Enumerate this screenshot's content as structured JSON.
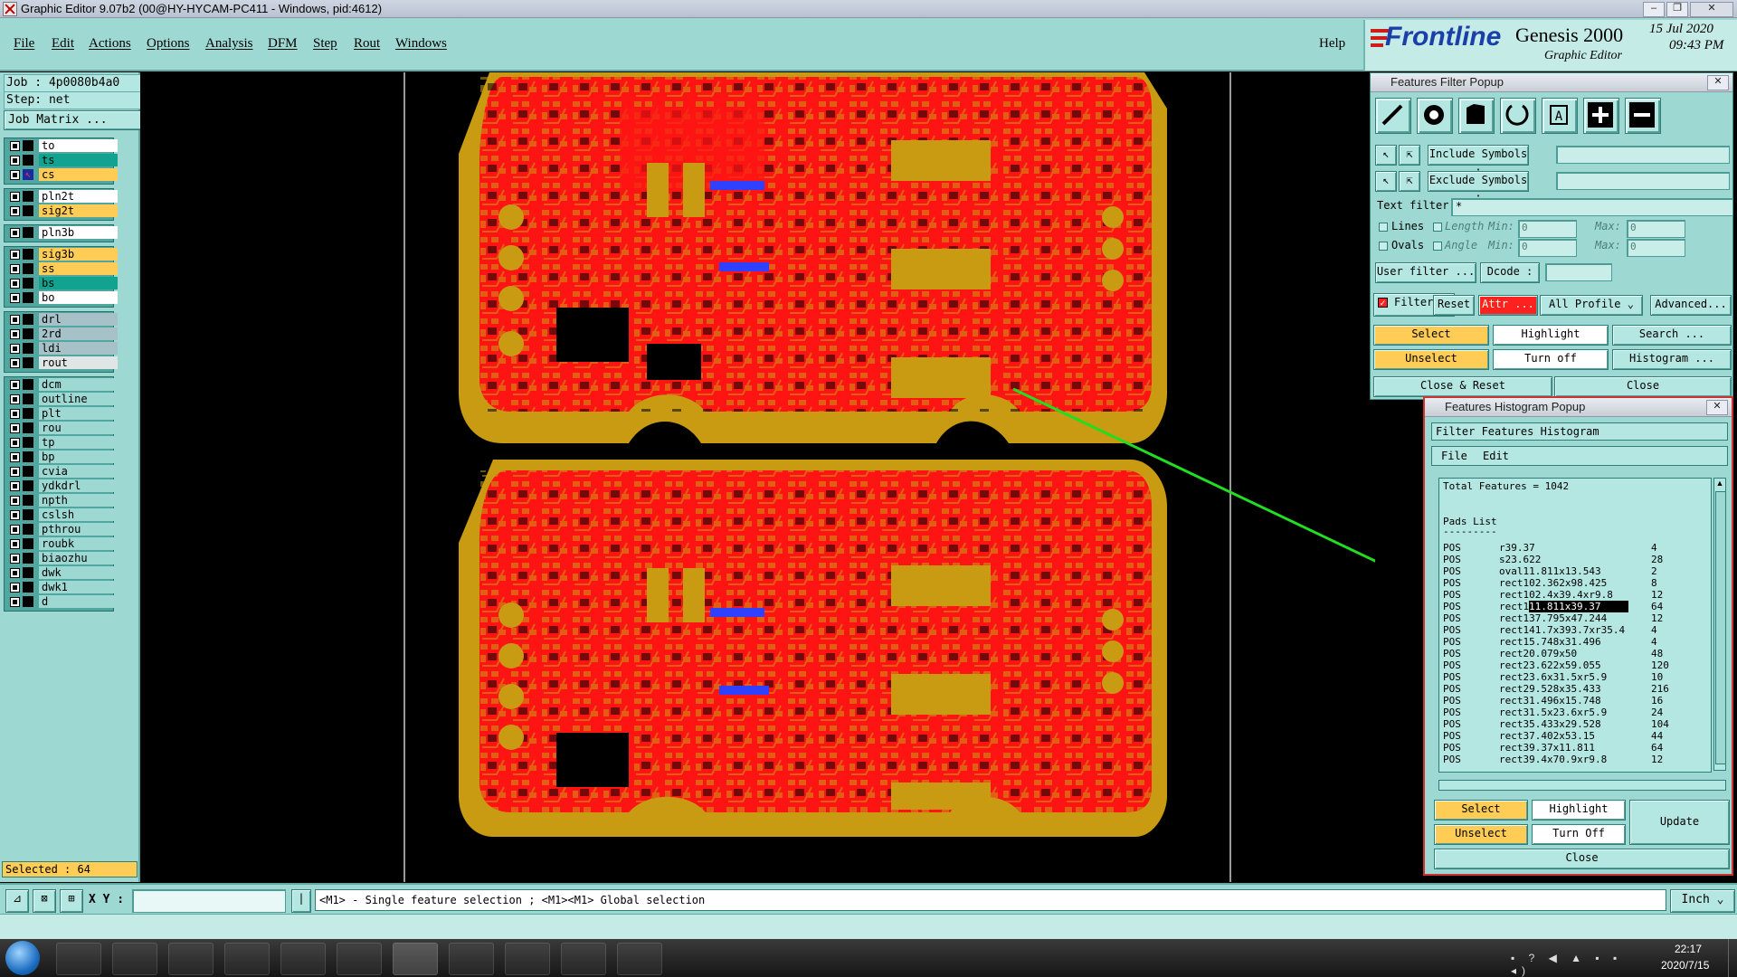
{
  "window": {
    "title": "Graphic Editor 9.07b2 (00@HY-HYCAM-PC411 - Windows, pid:4612)"
  },
  "menu": {
    "items": [
      "File",
      "Edit",
      "Actions",
      "Options",
      "Analysis",
      "DFM",
      "Step",
      "Rout",
      "Windows"
    ],
    "help": "Help"
  },
  "brand": {
    "logo": "Frontline",
    "product": "Genesis 2000",
    "module": "Graphic Editor",
    "date": "15 Jul 2020",
    "time": "09:43 PM"
  },
  "job": {
    "job_line": "Job : 4p0080b4a0",
    "step_line": "Step: net",
    "matrix_button": "Job Matrix ...",
    "selected": "Selected : 64"
  },
  "layers": [
    {
      "name": "to",
      "color": "#ffffff"
    },
    {
      "name": "ts",
      "color": "#11a38f"
    },
    {
      "name": "cs",
      "color": "#ffcc55",
      "active": true
    },
    {
      "name": "pln2t",
      "color": "#ffffff"
    },
    {
      "name": "sig2t",
      "color": "#ffcc55"
    },
    {
      "name": "pln3b",
      "color": "#ffffff"
    },
    {
      "name": "sig3b",
      "color": "#ffcc55"
    },
    {
      "name": "ss",
      "color": "#ffcc55"
    },
    {
      "name": "bs",
      "color": "#11a38f"
    },
    {
      "name": "bo",
      "color": "#ffffff"
    },
    {
      "name": "drl",
      "color": "#a6c2c8"
    },
    {
      "name": "2rd",
      "color": "#a6c2c8"
    },
    {
      "name": "ldi",
      "color": "#a6c2c8"
    },
    {
      "name": "rout",
      "color": "#e0e6e6"
    },
    {
      "name": "dcm",
      "color": "#9ed8d2"
    },
    {
      "name": "outline",
      "color": "#9ed8d2"
    },
    {
      "name": "plt",
      "color": "#9ed8d2"
    },
    {
      "name": "rou",
      "color": "#9ed8d2"
    },
    {
      "name": "tp",
      "color": "#9ed8d2"
    },
    {
      "name": "bp",
      "color": "#9ed8d2"
    },
    {
      "name": "cvia",
      "color": "#9ed8d2"
    },
    {
      "name": "ydkdrl",
      "color": "#9ed8d2"
    },
    {
      "name": "npth",
      "color": "#9ed8d2"
    },
    {
      "name": "cslsh",
      "color": "#9ed8d2"
    },
    {
      "name": "pthrou",
      "color": "#9ed8d2"
    },
    {
      "name": "roubk",
      "color": "#9ed8d2"
    },
    {
      "name": "biaozhu",
      "color": "#9ed8d2"
    },
    {
      "name": "dwk",
      "color": "#9ed8d2"
    },
    {
      "name": "dwk1",
      "color": "#9ed8d2"
    },
    {
      "name": "d",
      "color": "#9ed8d2"
    }
  ],
  "filter_popup": {
    "title": "Features Filter Popup",
    "include_symbols": "Include Symbols :",
    "exclude_symbols": "Exclude Symbols :",
    "text_filter": "Text filter",
    "text_filter_value": "*",
    "lines": "Lines",
    "ovals": "Ovals",
    "length": "Length",
    "angle": "Angle",
    "min": "Min:",
    "max": "Max:",
    "len_min": "0",
    "len_max": "0",
    "ang_min": "0",
    "ang_max": "0",
    "user_filter": "User filter ...",
    "dcode": "Dcode :",
    "filter": "Filter",
    "reset": "Reset",
    "attr": "Attr ...",
    "all_profile": "All Profile",
    "advanced": "Advanced...",
    "select": "Select",
    "highlight": "Highlight",
    "search": "Search ...",
    "unselect": "Unselect",
    "turn_off": "Turn off",
    "histogram": "Histogram ...",
    "close_reset": "Close & Reset",
    "close": "Close"
  },
  "histogram_popup": {
    "title": "Features Histogram Popup",
    "header": "Filter Features Histogram",
    "menu": [
      "File",
      "Edit"
    ],
    "total": "Total Features = 1042",
    "section": "Pads List",
    "rule": "---------",
    "rows": [
      {
        "pol": "POS",
        "sym": "r39.37",
        "count": "4"
      },
      {
        "pol": "POS",
        "sym": "s23.622",
        "count": "28"
      },
      {
        "pol": "POS",
        "sym": "oval11.811x13.543",
        "count": "2"
      },
      {
        "pol": "POS",
        "sym": "rect102.362x98.425",
        "count": "8"
      },
      {
        "pol": "POS",
        "sym": "rect102.4x39.4xr9.8",
        "count": "12"
      },
      {
        "pol": "POS",
        "sym": "rect11.811x39.37",
        "count": "64",
        "highlight": "11.811x39.37"
      },
      {
        "pol": "POS",
        "sym": "rect137.795x47.244",
        "count": "12"
      },
      {
        "pol": "POS",
        "sym": "rect141.7x393.7xr35.4",
        "count": "4"
      },
      {
        "pol": "POS",
        "sym": "rect15.748x31.496",
        "count": "4"
      },
      {
        "pol": "POS",
        "sym": "rect20.079x50",
        "count": "48"
      },
      {
        "pol": "POS",
        "sym": "rect23.622x59.055",
        "count": "120"
      },
      {
        "pol": "POS",
        "sym": "rect23.6x31.5xr5.9",
        "count": "10"
      },
      {
        "pol": "POS",
        "sym": "rect29.528x35.433",
        "count": "216"
      },
      {
        "pol": "POS",
        "sym": "rect31.496x15.748",
        "count": "16"
      },
      {
        "pol": "POS",
        "sym": "rect31.5x23.6xr5.9",
        "count": "24"
      },
      {
        "pol": "POS",
        "sym": "rect35.433x29.528",
        "count": "104"
      },
      {
        "pol": "POS",
        "sym": "rect37.402x53.15",
        "count": "44"
      },
      {
        "pol": "POS",
        "sym": "rect39.37x11.811",
        "count": "64"
      },
      {
        "pol": "POS",
        "sym": "rect39.4x70.9xr9.8",
        "count": "12"
      }
    ],
    "select": "Select",
    "highlight": "Highlight",
    "unselect": "Unselect",
    "turn_off": "Turn Off",
    "update": "Update",
    "close": "Close"
  },
  "status": {
    "xy_label": "X Y :",
    "hint": "<M1> - Single feature selection ; <M1><M1> Global selection",
    "units": "Inch"
  },
  "tray": {
    "time": "22:17",
    "date": "2020/7/15"
  },
  "colors": {
    "panel": "#9ed8d2",
    "board_red": "#ff1414",
    "board_gold": "#c89b12",
    "arrow": "#22dd22"
  }
}
